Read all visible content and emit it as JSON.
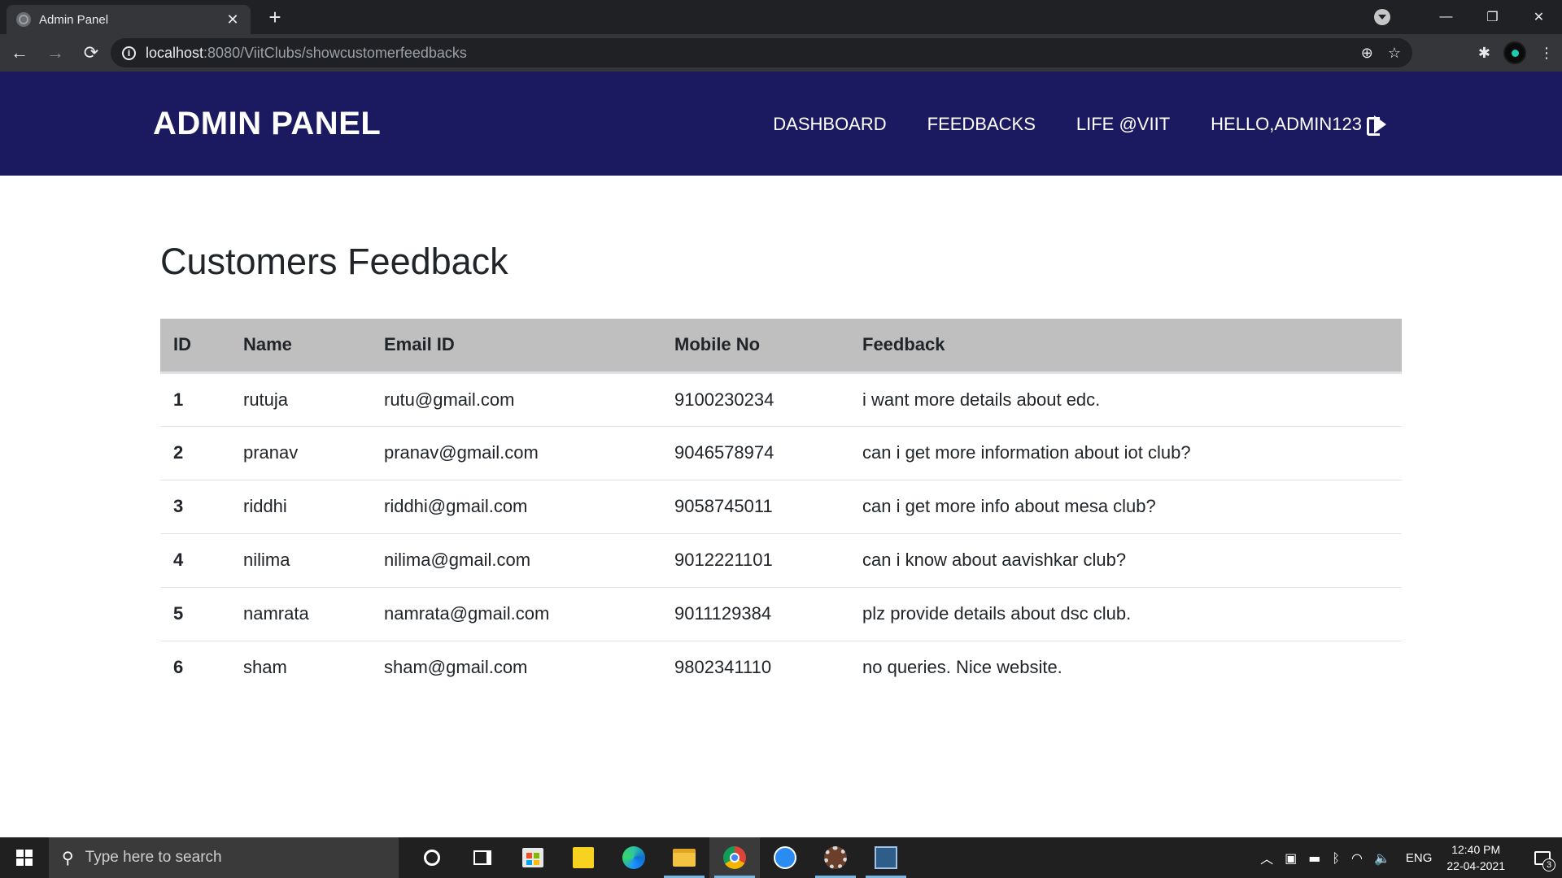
{
  "browser": {
    "tab_title": "Admin Panel",
    "tab_close": "✕",
    "new_tab": "+",
    "url_host": "localhost",
    "url_path": ":8080/ViitClubs/showcustomerfeedbacks",
    "window_controls": {
      "minimize": "—",
      "restore": "❐",
      "close": "✕"
    }
  },
  "header": {
    "brand": "ADMIN PANEL",
    "nav": {
      "dashboard": "DASHBOARD",
      "feedbacks": "FEEDBACKS",
      "life": "LIFE @VIIT",
      "user": "HELLO,ADMIN123"
    },
    "color": "#1b1a60"
  },
  "main": {
    "title": "Customers Feedback",
    "table": {
      "headers": [
        "ID",
        "Name",
        "Email ID",
        "Mobile No",
        "Feedback"
      ],
      "rows": [
        [
          "1",
          "rutuja",
          "rutu@gmail.com",
          "9100230234",
          "i want more details about edc."
        ],
        [
          "2",
          "pranav",
          "pranav@gmail.com",
          "9046578974",
          "can i get more information about iot club?"
        ],
        [
          "3",
          "riddhi",
          "riddhi@gmail.com",
          "9058745011",
          "can i get more info about mesa club?"
        ],
        [
          "4",
          "nilima",
          "nilima@gmail.com",
          "9012221101",
          "can i know about aavishkar club?"
        ],
        [
          "5",
          "namrata",
          "namrata@gmail.com",
          "9011129384",
          "plz provide details about dsc club."
        ],
        [
          "6",
          "sham",
          "sham@gmail.com",
          "9802341110",
          "no queries. Nice website."
        ]
      ],
      "header_bg": "#bfbfbf"
    }
  },
  "taskbar": {
    "search_placeholder": "Type here to search",
    "lang": "ENG",
    "time": "12:40 PM",
    "date": "22-04-2021",
    "notification_count": "3"
  }
}
